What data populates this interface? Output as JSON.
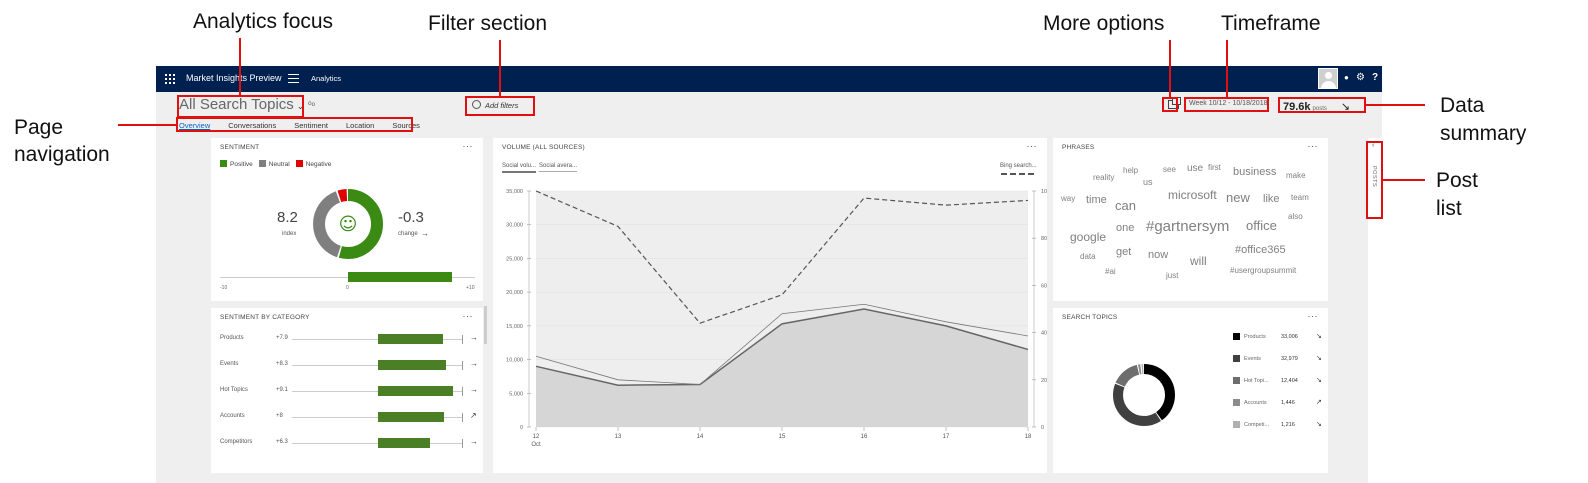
{
  "callouts": {
    "analytics_focus": "Analytics focus",
    "filter_section": "Filter section",
    "more_options": "More options",
    "timeframe": "Timeframe",
    "page_navigation_1": "Page",
    "page_navigation_2": "navigation",
    "data_summary_1": "Data",
    "data_summary_2": "summary",
    "post_list_1": "Post",
    "post_list_2": "list"
  },
  "colors": {
    "topbar": "#002050",
    "positive": "#3a8a14",
    "neutral": "#7f7f7f",
    "negative": "#e00000",
    "category_bar": "#4a7f26",
    "callout_red": "#e01010"
  },
  "topbar": {
    "app_name": "Market Insights Preview",
    "crumb": "Analytics",
    "icons": [
      "waffle-icon",
      "hamburger-icon",
      "avatar",
      "status-dot-icon",
      "gear-icon",
      "help-icon"
    ],
    "status_dot": "●",
    "gear": "⚙",
    "help": "?"
  },
  "header": {
    "focus_label": "All Search Topics",
    "focus_chevron": "⌄",
    "share_icon": "⁰ᵒ",
    "add_filters": "Add filters",
    "timeframe": "Week 10/12 - 10/18/2018",
    "summary_value": "79.6k",
    "summary_unit": "posts",
    "summary_arrow": "↘"
  },
  "nav_tabs": [
    "Overview",
    "Conversations",
    "Sentiment",
    "Location",
    "Sources"
  ],
  "sentiment": {
    "title": "SENTIMENT",
    "legend": [
      "Positive",
      "Neutral",
      "Negative"
    ],
    "index_value": "8.2",
    "index_label": "index",
    "change_value": "-0.3",
    "change_label": "change",
    "change_arrow": "→",
    "axis_min": "-10",
    "axis_mid": "0",
    "axis_max": "+10",
    "index_bar_fraction": 0.82,
    "donut_shares": {
      "positive": 0.55,
      "neutral": 0.4,
      "negative": 0.05
    },
    "face": "☺"
  },
  "sentiment_by_category": {
    "title": "SENTIMENT BY CATEGORY",
    "rows": [
      {
        "label": "Products",
        "value": "+7.9",
        "score": 7.9,
        "arrow": "→"
      },
      {
        "label": "Events",
        "value": "+8.3",
        "score": 8.3,
        "arrow": "→"
      },
      {
        "label": "Hot Topics",
        "value": "+9.1",
        "score": 9.1,
        "arrow": "→"
      },
      {
        "label": "Accounts",
        "value": "+8",
        "score": 8.0,
        "arrow": "↗"
      },
      {
        "label": "Competitors",
        "value": "+6.3",
        "score": 6.3,
        "arrow": "→"
      }
    ]
  },
  "volume": {
    "title": "VOLUME (ALL SOURCES)",
    "tabs": [
      "Social volu...",
      "Social avera..."
    ],
    "bing_label": "Bing search..."
  },
  "chart_data": {
    "type": "line",
    "x": [
      "12",
      "13",
      "14",
      "15",
      "16",
      "17",
      "18"
    ],
    "x_sub": "Oct",
    "ylim": [
      0,
      35000
    ],
    "y_ticks": [
      "0",
      "5,000",
      "10,000",
      "15,000",
      "20,000",
      "25,000",
      "30,000",
      "35,000"
    ],
    "y2lim": [
      0,
      100
    ],
    "y2_ticks": [
      "0",
      "20",
      "40",
      "60",
      "80",
      "100"
    ],
    "series": [
      {
        "name": "Social volu...",
        "axis": "left",
        "style": "area",
        "values": [
          9000,
          6200,
          6300,
          15300,
          17500,
          15000,
          11500
        ]
      },
      {
        "name": "Social avera...",
        "axis": "left",
        "style": "line",
        "values": [
          10500,
          7000,
          6300,
          16800,
          18200,
          15600,
          13500
        ]
      },
      {
        "name": "Bing search...",
        "axis": "right",
        "style": "dashed",
        "values": [
          100,
          85,
          44,
          56,
          97,
          94,
          96
        ]
      }
    ]
  },
  "phrases": {
    "title": "PHRASES",
    "words": [
      "reality",
      "help",
      "us",
      "see",
      "use",
      "first",
      "business",
      "make",
      "way",
      "time",
      "can",
      "microsoft",
      "new",
      "like",
      "team",
      "one",
      "#gartnersym",
      "office",
      "also",
      "google",
      "get",
      "now",
      "will",
      "#office365",
      "data",
      "#ai",
      "just",
      "#usergroupsummit"
    ]
  },
  "search_topics": {
    "title": "SEARCH TOPICS",
    "rows": [
      {
        "label": "Products",
        "value": "33,006",
        "count": 33006,
        "color": "#000000",
        "arrow": "↘"
      },
      {
        "label": "Events",
        "value": "32,979",
        "count": 32979,
        "color": "#404040",
        "arrow": "↘"
      },
      {
        "label": "Hot Topi...",
        "value": "12,404",
        "count": 12404,
        "color": "#6e6e6e",
        "arrow": "↘"
      },
      {
        "label": "Accounts",
        "value": "1,446",
        "count": 1446,
        "color": "#8c8c8c",
        "arrow": "↗"
      },
      {
        "label": "Competi...",
        "value": "1,216",
        "count": 1216,
        "color": "#b0b0b0",
        "arrow": "↘"
      }
    ]
  },
  "posts_rail": {
    "label": "POSTS",
    "chevron": "‹"
  },
  "card_menu": "···"
}
